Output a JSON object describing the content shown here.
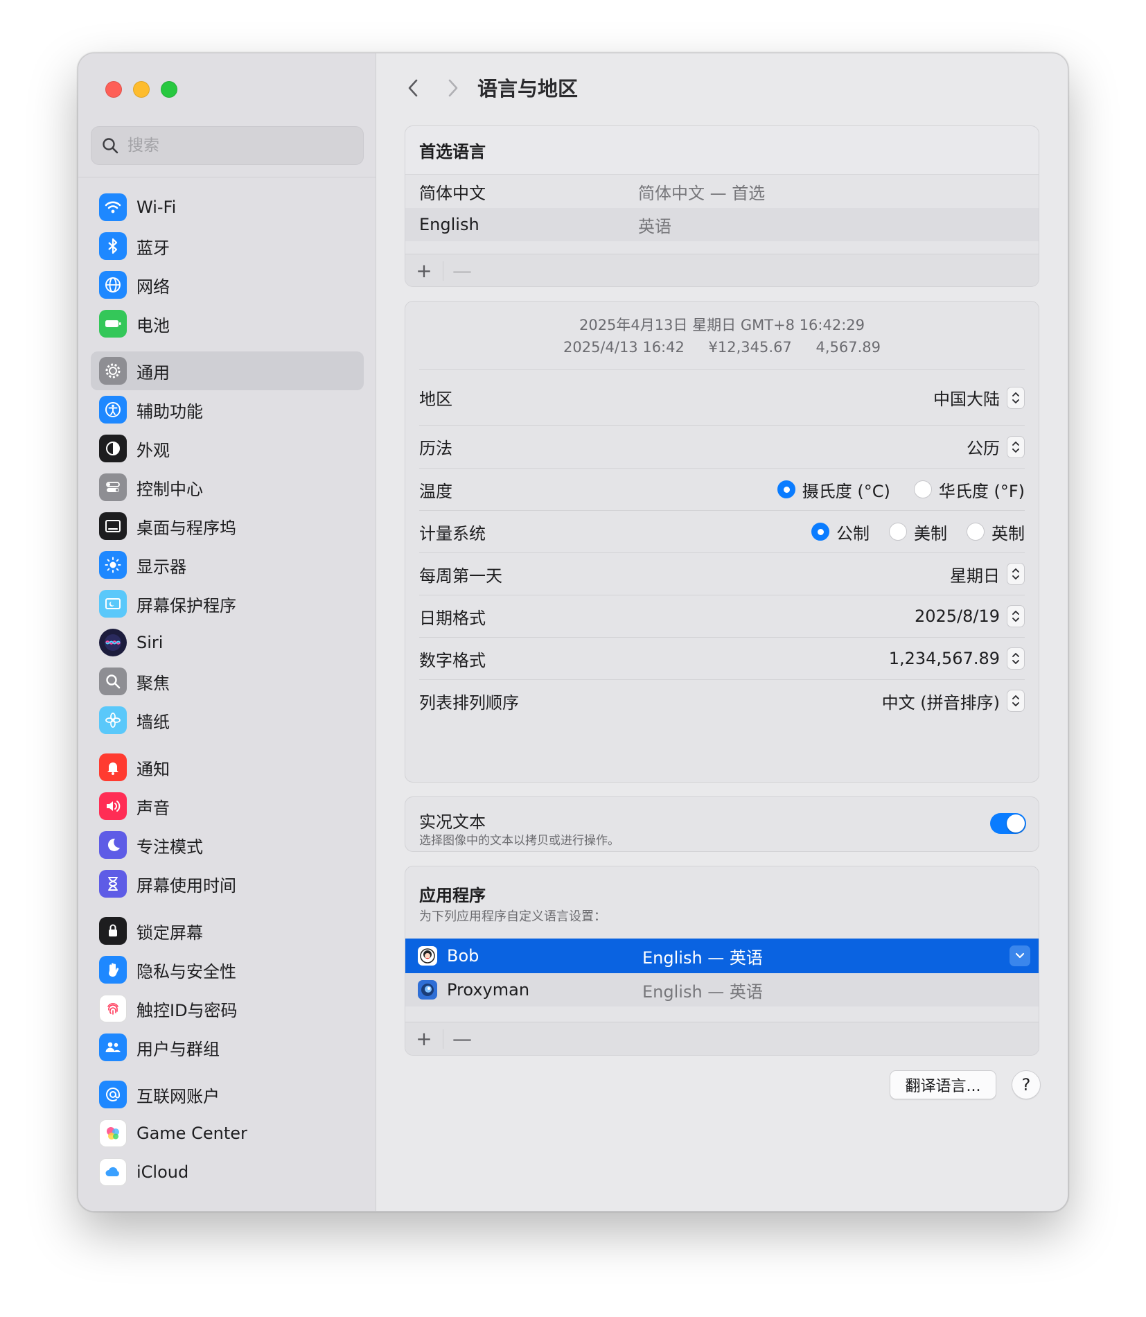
{
  "search": {
    "placeholder": "搜索"
  },
  "sidebar": {
    "groups": [
      [
        {
          "label": "Wi-Fi",
          "icon": "wifi-icon",
          "color": "#1e88ff"
        },
        {
          "label": "蓝牙",
          "icon": "bluetooth-icon",
          "color": "#1e88ff"
        },
        {
          "label": "网络",
          "icon": "globe-icon",
          "color": "#1e88ff"
        },
        {
          "label": "电池",
          "icon": "battery-icon",
          "color": "#34c759"
        }
      ],
      [
        {
          "label": "通用",
          "icon": "gear-icon",
          "color": "#8e8e93",
          "active": true
        },
        {
          "label": "辅助功能",
          "icon": "accessibility-icon",
          "color": "#1e88ff"
        },
        {
          "label": "外观",
          "icon": "appearance-icon",
          "color": "#1d1d1f"
        },
        {
          "label": "控制中心",
          "icon": "control-center-icon",
          "color": "#8e8e93"
        },
        {
          "label": "桌面与程序坞",
          "icon": "dock-icon",
          "color": "#1d1d1f"
        },
        {
          "label": "显示器",
          "icon": "display-icon",
          "color": "#1e88ff"
        },
        {
          "label": "屏幕保护程序",
          "icon": "screensaver-icon",
          "color": "#5ac8fa"
        },
        {
          "label": "Siri",
          "icon": "siri-icon",
          "color": "#2b2b6e"
        },
        {
          "label": "聚焦",
          "icon": "spotlight-icon",
          "color": "#8e8e93"
        },
        {
          "label": "墙纸",
          "icon": "wallpaper-icon",
          "color": "#5ac8fa"
        }
      ],
      [
        {
          "label": "通知",
          "icon": "notification-icon",
          "color": "#ff3b30"
        },
        {
          "label": "声音",
          "icon": "sound-icon",
          "color": "#ff2d55"
        },
        {
          "label": "专注模式",
          "icon": "focus-moon-icon",
          "color": "#5e5ce6"
        },
        {
          "label": "屏幕使用时间",
          "icon": "hourglass-icon",
          "color": "#5e5ce6"
        }
      ],
      [
        {
          "label": "锁定屏幕",
          "icon": "lock-screen-icon",
          "color": "#1d1d1f"
        },
        {
          "label": "隐私与安全性",
          "icon": "hand-icon",
          "color": "#1e88ff"
        },
        {
          "label": "触控ID与密码",
          "icon": "fingerprint-icon",
          "color": "#ffffff"
        },
        {
          "label": "用户与群组",
          "icon": "users-icon",
          "color": "#1e88ff"
        }
      ],
      [
        {
          "label": "互联网账户",
          "icon": "at-icon",
          "color": "#1e88ff"
        },
        {
          "label": "Game Center",
          "icon": "game-center-icon",
          "color": "#ffffff"
        },
        {
          "label": "iCloud",
          "icon": "cloud-icon",
          "color": "#ffffff"
        }
      ]
    ]
  },
  "header": {
    "title": "语言与地区"
  },
  "preferred": {
    "title": "首选语言",
    "rows": [
      {
        "name": "简体中文",
        "desc": "简体中文 — 首选"
      },
      {
        "name": "English",
        "desc": "英语"
      }
    ],
    "add": "+",
    "remove": "—"
  },
  "region": {
    "preview_line1": "2025年4月13日 星期日 GMT+8 16:42:29",
    "preview_date": "2025/4/13 16:42",
    "preview_currency": "¥12,345.67",
    "preview_number": "4,567.89",
    "region_label": "地区",
    "region_value": "中国大陆",
    "calendar_label": "历法",
    "calendar_value": "公历",
    "temperature_label": "温度",
    "temperature_options": [
      "摄氏度 (°C)",
      "华氏度 (°F)"
    ],
    "temperature_selected": 0,
    "measure_label": "计量系统",
    "measure_options": [
      "公制",
      "美制",
      "英制"
    ],
    "measure_selected": 0,
    "week_label": "每周第一天",
    "week_value": "星期日",
    "date_label": "日期格式",
    "date_value": "2025/8/19",
    "number_label": "数字格式",
    "number_value": "1,234,567.89",
    "sort_label": "列表排列顺序",
    "sort_value": "中文 (拼音排序)"
  },
  "live_text": {
    "title": "实况文本",
    "subtitle": "选择图像中的文本以拷贝或进行操作。",
    "enabled": true
  },
  "apps": {
    "title": "应用程序",
    "subtitle": "为下列应用程序自定义语言设置：",
    "rows": [
      {
        "name": "Bob",
        "lang": "English — 英语",
        "selected": true
      },
      {
        "name": "Proxyman",
        "lang": "English — 英语",
        "selected": false
      }
    ],
    "add": "+",
    "remove": "—"
  },
  "buttons": {
    "translate": "翻译语言...",
    "help": "?"
  },
  "colors": {
    "accent": "#0a7cff",
    "selection": "#0a63e1"
  }
}
